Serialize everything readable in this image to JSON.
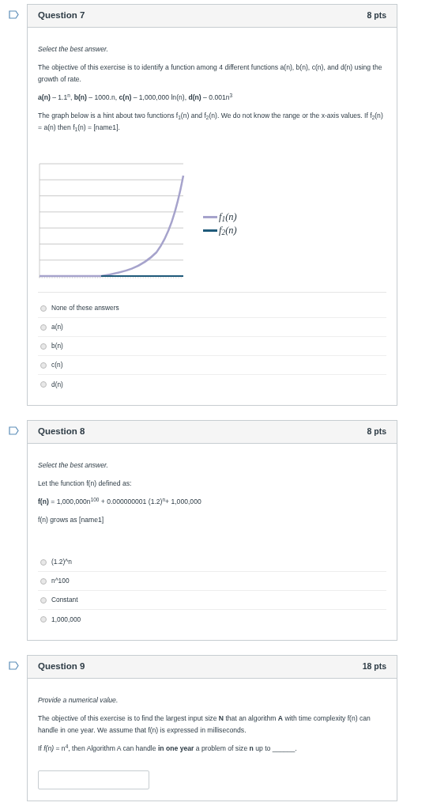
{
  "questions": [
    {
      "title": "Question 7",
      "points": "8 pts",
      "instruction": "Select the best answer.",
      "paragraphs": [
        "The objective of this exercise is to identify a function among 4 different functions a(n), b(n), c(n), and d(n) using the growth of rate.",
        "**a(n)** – 1.1$^{n}$, **b(n)** – 1000.n, **c(n)** – 1,000,000 ln(n), **d(n)** – 0.001n$^{3}$",
        "The graph below is a hint about two functions f$_{1}$(n) and f$_{2}$(n). We do not know the range or the x-axis values. If f$_{2}$(n) = a(n) then f$_{1}$(n) = [name1]."
      ],
      "graph": {
        "legend": [
          {
            "label": "f$_{1}$(n)",
            "color": "#a6a3cc"
          },
          {
            "label": "f$_{2}$(n)",
            "color": "#1f5a7a"
          }
        ]
      },
      "answers": [
        {
          "label": "None of these answers",
          "selected": false
        },
        {
          "label": "a(n)",
          "selected": false
        },
        {
          "label": "b(n)",
          "selected": false
        },
        {
          "label": "c(n)",
          "selected": false
        },
        {
          "label": "d(n)",
          "selected": false
        }
      ]
    },
    {
      "title": "Question 8",
      "points": "8 pts",
      "instruction": "Select the best answer.",
      "paragraphs": [
        "Let the function f(n) defined as:",
        "**f(n)** = 1,000,000n$^{100}$ + 0.000000001 (1.2)$^{n}$+ 1,000,000",
        "f(n) grows as [name1]"
      ],
      "answers": [
        {
          "label": "(1.2)^n",
          "selected": false
        },
        {
          "label": "n^100",
          "selected": false
        },
        {
          "label": "Constant",
          "selected": false
        },
        {
          "label": "1,000,000",
          "selected": false
        }
      ]
    },
    {
      "title": "Question 9",
      "points": "18 pts",
      "instruction": "Provide a numerical value.",
      "paragraphs": [
        "The objective of this exercise is to find the largest input size **N** that an algorithm **A** with time complexity f(n) can handle in one year. We assume that f(n) is expressed in milliseconds.",
        "If *f(n)* = n$^{4}$, then Algorithm A can handle **in one year** a problem of size **n** up to ______."
      ],
      "input": {
        "kind": "text"
      }
    }
  ]
}
